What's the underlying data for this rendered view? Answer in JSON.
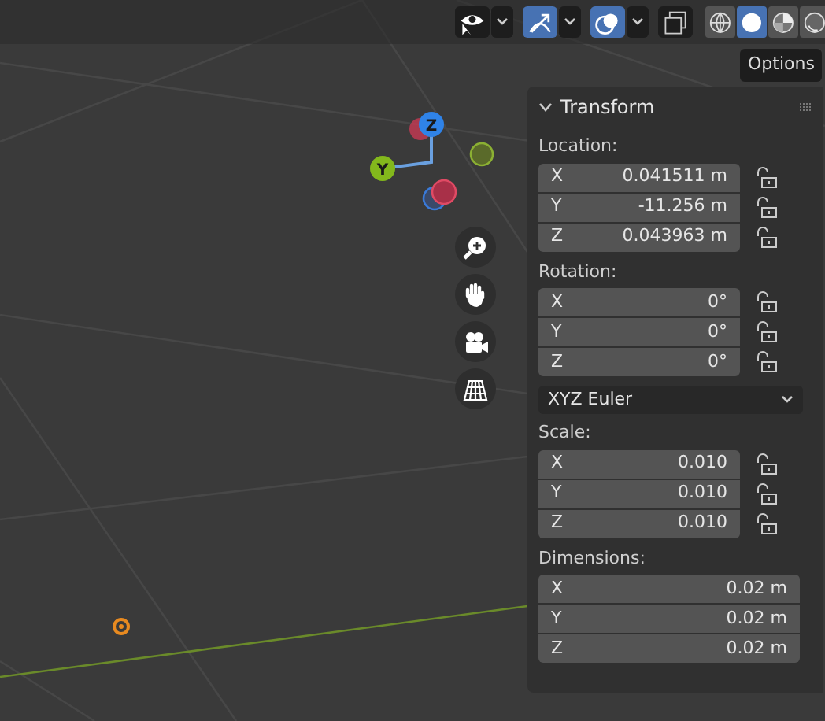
{
  "header": {
    "toggles": [
      {
        "kind": "visibility",
        "selected": false,
        "dropdown": true
      },
      {
        "kind": "gizmo",
        "selected": true,
        "dropdown": true
      },
      {
        "kind": "overlays",
        "selected": true,
        "dropdown": true
      },
      {
        "kind": "xray",
        "selected": false,
        "dropdown": false
      }
    ],
    "shading": [
      {
        "kind": "wireframe",
        "selected": false
      },
      {
        "kind": "solid",
        "selected": true
      },
      {
        "kind": "material",
        "selected": false
      },
      {
        "kind": "rendered",
        "selected": false
      }
    ]
  },
  "tooltip": "Options",
  "gizmo": {
    "axes": [
      {
        "label": "Z",
        "color": "#2f83e8"
      },
      {
        "label": "Y",
        "color": "#83b81c"
      }
    ]
  },
  "navigation": [
    {
      "kind": "zoom"
    },
    {
      "kind": "pan"
    },
    {
      "kind": "camera"
    },
    {
      "kind": "perspective"
    }
  ],
  "panel": {
    "title": "Transform",
    "expanded": true,
    "sections": [
      {
        "label": "Location:",
        "rows": [
          {
            "axis": "X",
            "value": "0.041511 m",
            "locked": false
          },
          {
            "axis": "Y",
            "value": "-11.256 m",
            "locked": false
          },
          {
            "axis": "Z",
            "value": "0.043963 m",
            "locked": false
          }
        ]
      },
      {
        "label": "Rotation:",
        "rows": [
          {
            "axis": "X",
            "value": "0°",
            "locked": false
          },
          {
            "axis": "Y",
            "value": "0°",
            "locked": false
          },
          {
            "axis": "Z",
            "value": "0°",
            "locked": false
          }
        ],
        "mode": "XYZ Euler"
      },
      {
        "label": "Scale:",
        "rows": [
          {
            "axis": "X",
            "value": "0.010",
            "locked": false
          },
          {
            "axis": "Y",
            "value": "0.010",
            "locked": false
          },
          {
            "axis": "Z",
            "value": "0.010",
            "locked": false
          }
        ]
      },
      {
        "label": "Dimensions:",
        "rows": [
          {
            "axis": "X",
            "value": "0.02 m"
          },
          {
            "axis": "Y",
            "value": "0.02 m"
          },
          {
            "axis": "Z",
            "value": "0.02 m"
          }
        ]
      }
    ]
  }
}
